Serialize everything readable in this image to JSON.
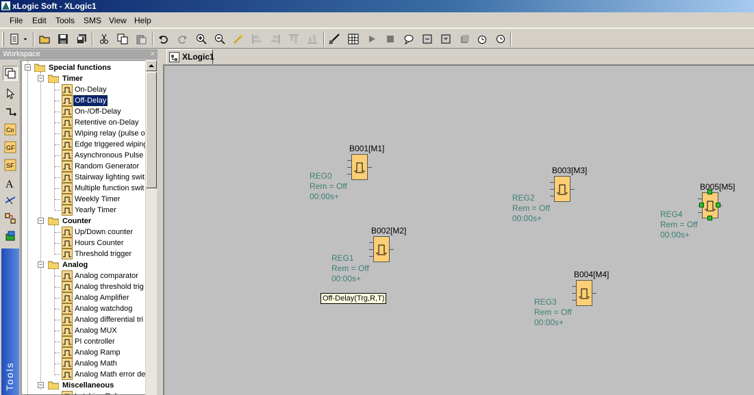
{
  "title": "xLogic Soft - XLogic1",
  "menu": [
    "File",
    "Edit",
    "Tools",
    "SMS",
    "View",
    "Help"
  ],
  "workspace": {
    "label": "Workspace",
    "close": "×"
  },
  "tools_label": "Tools",
  "tree": {
    "special_functions": "Special functions",
    "timer": "Timer",
    "timer_items": [
      "On-Delay",
      "Off-Delay",
      "On-/Off-Delay",
      "Retentive on-Delay",
      "Wiping relay (pulse ou",
      "Edge triggered wiping",
      "Asynchronous Pulse G",
      "Random Generator",
      "Stairway lighting swit",
      "Multiple function swit",
      "Weekly Timer",
      "Yearly Timer"
    ],
    "counter": "Counter",
    "counter_items": [
      "Up/Down counter",
      "Hours Counter",
      "Threshold trigger"
    ],
    "analog": "Analog",
    "analog_items": [
      "Analog comparator",
      "Analog threshold trig",
      "Analog Amplifier",
      "Analog watchdog",
      "Analog differential tri",
      "Analog MUX",
      "PI controller",
      "Analog Ramp",
      "Analog Math",
      "Analog Math error de"
    ],
    "misc": "Miscellaneous",
    "misc_items": [
      "Latching Relay"
    ],
    "selected": "Off-Delay"
  },
  "doc_tab": "XLogic1",
  "blocks": [
    {
      "name": "B001[M1]",
      "reg": "REG0",
      "rem": "Rem = Off",
      "time": "00:00s+"
    },
    {
      "name": "B002[M2]",
      "reg": "REG1",
      "rem": "Rem = Off",
      "time": "00:00s+"
    },
    {
      "name": "B003[M3]",
      "reg": "REG2",
      "rem": "Rem = Off",
      "time": "00:00s+"
    },
    {
      "name": "B004[M4]",
      "reg": "REG3",
      "rem": "Rem = Off",
      "time": "00:00s+"
    },
    {
      "name": "B005[M5]",
      "reg": "REG4",
      "rem": "Rem = Off",
      "time": "00:00s+"
    }
  ],
  "tooltip": "Off-Delay(Trg,R,T)",
  "colors": {
    "block_fill": "#fccf75",
    "reg_text": "#3c7e74",
    "canvas": "#c0c0c0",
    "selection": "#0a246a",
    "handle": "#2ec22e"
  }
}
